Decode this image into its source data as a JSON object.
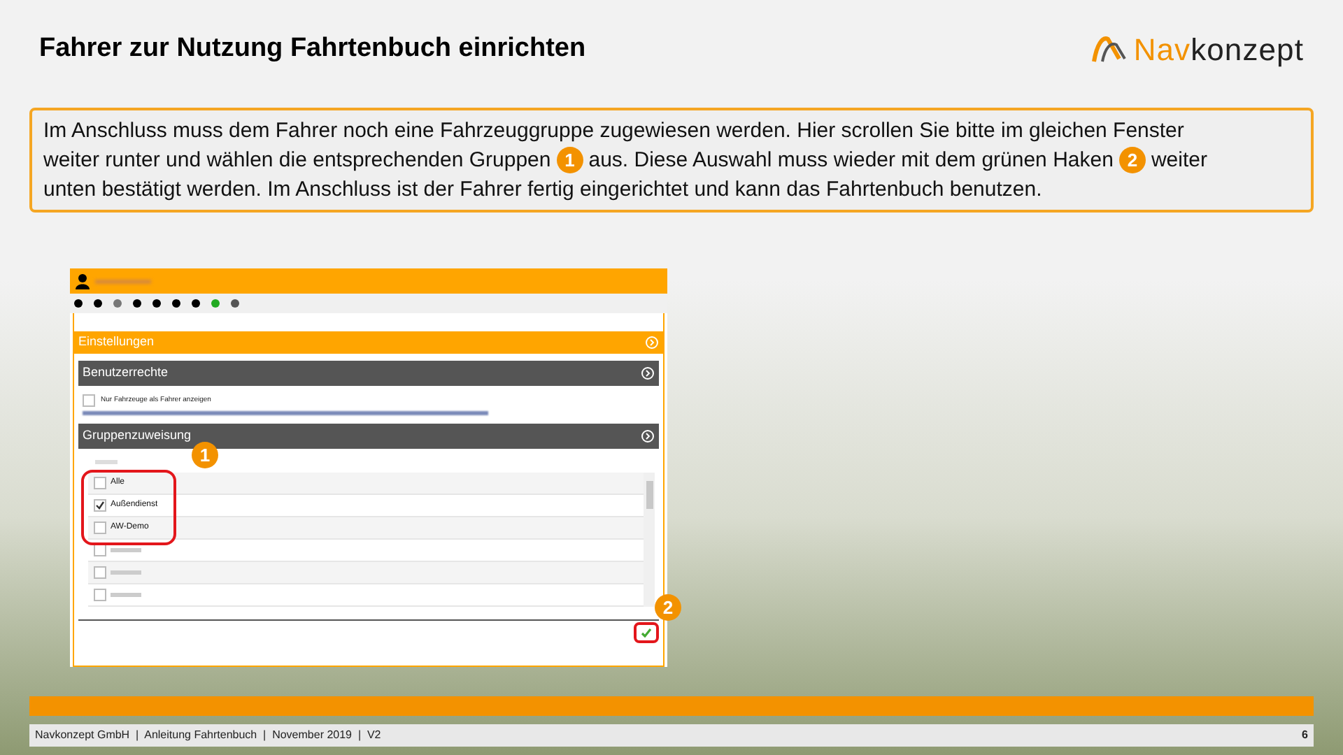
{
  "title": "Fahrer zur Nutzung Fahrtenbuch einrichten",
  "logo": {
    "part_1": "Nav",
    "part_2": "konzept"
  },
  "callout": [
    [
      {
        "kind": "text",
        "text": "Im Anschluss muss dem Fahrer noch eine Fahrzeuggruppe zugewiesen werden. Hier scrollen Sie bitte im gleichen Fenster"
      }
    ],
    [
      {
        "kind": "text",
        "text": "weiter runter und wählen die entsprechenden Gruppen"
      },
      {
        "kind": "badge",
        "text": "1"
      },
      {
        "kind": "text",
        "text": "aus. Diese Auswahl muss wieder mit dem grünen Haken"
      },
      {
        "kind": "badge",
        "text": "2"
      },
      {
        "kind": "text",
        "text": "weiter"
      }
    ],
    [
      {
        "kind": "text",
        "text": "unten bestätigt werden. Im Anschluss ist der Fahrer fertig eingerichtet und kann das Fahrtenbuch benutzen."
      }
    ]
  ],
  "app": {
    "settings_header": "Einstellungen",
    "sections": [
      {
        "title": "Benutzerrechte"
      },
      {
        "title": "Gruppenzuweisung"
      }
    ],
    "rights_option": {
      "label": "Nur Fahrzeuge als Fahrer anzeigen",
      "checked": false
    },
    "groups": [
      {
        "label": "Alle",
        "checked": false,
        "highlighted": true
      },
      {
        "label": "Außendienst",
        "checked": true,
        "highlighted": true
      },
      {
        "label": "AW-Demo",
        "checked": false,
        "highlighted": true
      },
      {
        "checked": false,
        "highlighted": false
      },
      {
        "checked": false,
        "highlighted": false
      },
      {
        "checked": false,
        "highlighted": false
      }
    ],
    "marker_groups": "1",
    "marker_confirm": "2"
  },
  "footer": {
    "text": "Navkonzept GmbH  |  Anleitung Fahrtenbuch  |  November 2019  |  V2",
    "page": "6"
  }
}
